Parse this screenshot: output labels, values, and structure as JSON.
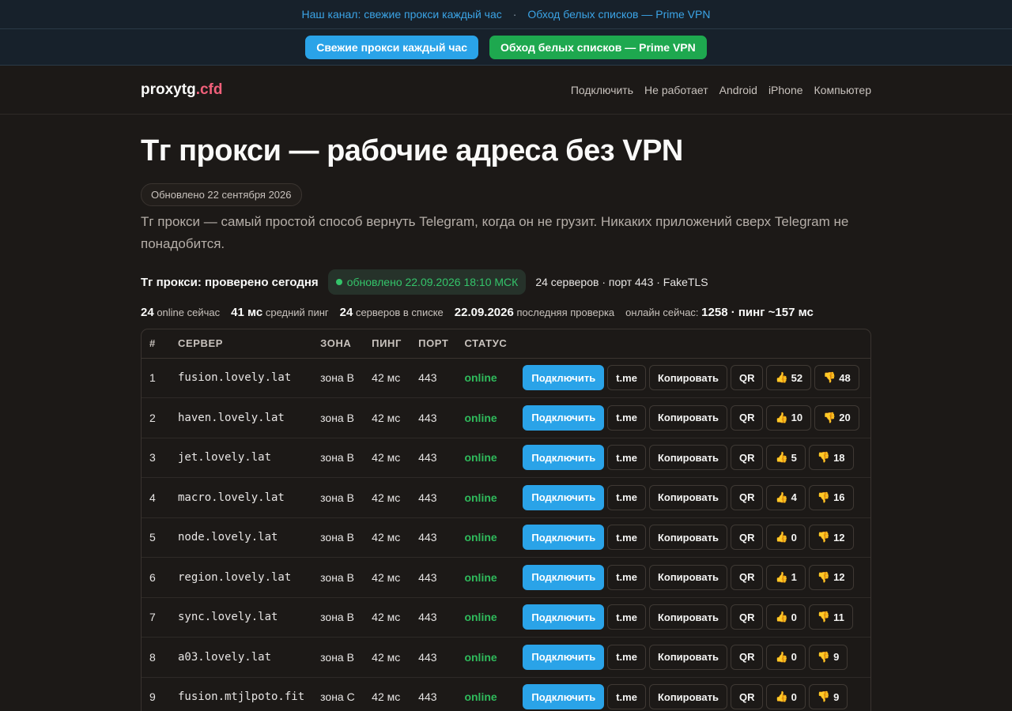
{
  "topbar": {
    "link1": "Наш канал: свежие прокси каждый час",
    "separator": "·",
    "link2": "Обход белых списков — Prime VPN"
  },
  "promo": {
    "btn1": "Свежие прокси каждый час",
    "btn2": "Обход белых списков — Prime VPN"
  },
  "header": {
    "logo_name": "proxytg",
    "logo_tld": ".cfd",
    "nav": [
      "Подключить",
      "Не работает",
      "Android",
      "iPhone",
      "Компьютер"
    ]
  },
  "page": {
    "title": "Тг прокси — рабочие адреса без VPN",
    "updated": "Обновлено 22 сентября 2026",
    "lead": "Тг прокси — самый простой способ вернуть Telegram, когда он не грузит. Никаких приложений сверх Telegram не понадобится."
  },
  "check": {
    "title": "Тг прокси: проверено сегодня",
    "badge": "обновлено 22.09.2026 18:10 МСК",
    "meta": "24 серверов · порт 443 · FakeTLS"
  },
  "stats": [
    {
      "value": "24",
      "label": "online сейчас"
    },
    {
      "value": "41 мс",
      "label": "средний пинг"
    },
    {
      "value": "24",
      "label": "серверов в списке"
    },
    {
      "value": "22.09.2026",
      "label": "последняя проверка"
    },
    {
      "value": "1258 · пинг ~157 мс",
      "label": "онлайн сейчас:"
    }
  ],
  "table": {
    "headers": [
      "#",
      "СЕРВЕР",
      "ЗОНА",
      "ПИНГ",
      "ПОРТ",
      "СТАТУС",
      ""
    ],
    "action_labels": {
      "connect": "Подключить",
      "tme": "t.me",
      "copy": "Копировать",
      "qr": "QR"
    },
    "icons": {
      "like": "👍",
      "dislike": "👎"
    },
    "rows": [
      {
        "n": "1",
        "host": "fusion.lovely.lat",
        "zone": "зона B",
        "ping": "42 мс",
        "port": "443",
        "status": "online",
        "likes": "52",
        "dislikes": "48"
      },
      {
        "n": "2",
        "host": "haven.lovely.lat",
        "zone": "зона B",
        "ping": "42 мс",
        "port": "443",
        "status": "online",
        "likes": "10",
        "dislikes": "20"
      },
      {
        "n": "3",
        "host": "jet.lovely.lat",
        "zone": "зона B",
        "ping": "42 мс",
        "port": "443",
        "status": "online",
        "likes": "5",
        "dislikes": "18"
      },
      {
        "n": "4",
        "host": "macro.lovely.lat",
        "zone": "зона B",
        "ping": "42 мс",
        "port": "443",
        "status": "online",
        "likes": "4",
        "dislikes": "16"
      },
      {
        "n": "5",
        "host": "node.lovely.lat",
        "zone": "зона B",
        "ping": "42 мс",
        "port": "443",
        "status": "online",
        "likes": "0",
        "dislikes": "12"
      },
      {
        "n": "6",
        "host": "region.lovely.lat",
        "zone": "зона B",
        "ping": "42 мс",
        "port": "443",
        "status": "online",
        "likes": "1",
        "dislikes": "12"
      },
      {
        "n": "7",
        "host": "sync.lovely.lat",
        "zone": "зона B",
        "ping": "42 мс",
        "port": "443",
        "status": "online",
        "likes": "0",
        "dislikes": "11"
      },
      {
        "n": "8",
        "host": "a03.lovely.lat",
        "zone": "зона B",
        "ping": "42 мс",
        "port": "443",
        "status": "online",
        "likes": "0",
        "dislikes": "9"
      },
      {
        "n": "9",
        "host": "fusion.mtjlpoto.fit",
        "zone": "зона C",
        "ping": "42 мс",
        "port": "443",
        "status": "online",
        "likes": "0",
        "dislikes": "9"
      }
    ]
  },
  "colors": {
    "background": "#1c1917",
    "accent_blue": "#2aa3e8",
    "accent_green": "#1ea84f",
    "online_green": "#2fbb5c",
    "logo_tld": "#f0607a"
  }
}
